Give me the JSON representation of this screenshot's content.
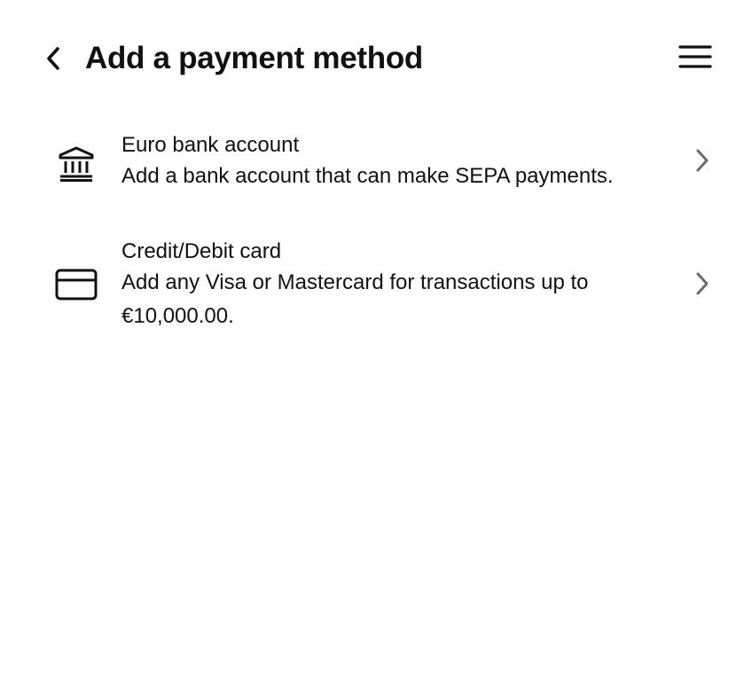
{
  "header": {
    "title": "Add a payment method",
    "back_icon": "chevron-left-icon",
    "menu_icon": "hamburger-menu-icon"
  },
  "methods": [
    {
      "icon": "bank-icon",
      "title": "Euro bank account",
      "description": "Add a bank account that can make SEPA payments."
    },
    {
      "icon": "credit-card-icon",
      "title": "Credit/Debit card",
      "description": "Add any Visa or Mastercard for transactions up to €10,000.00."
    }
  ],
  "colors": {
    "text": "#111111",
    "chevron": "#6b6b6b",
    "background": "#ffffff"
  }
}
